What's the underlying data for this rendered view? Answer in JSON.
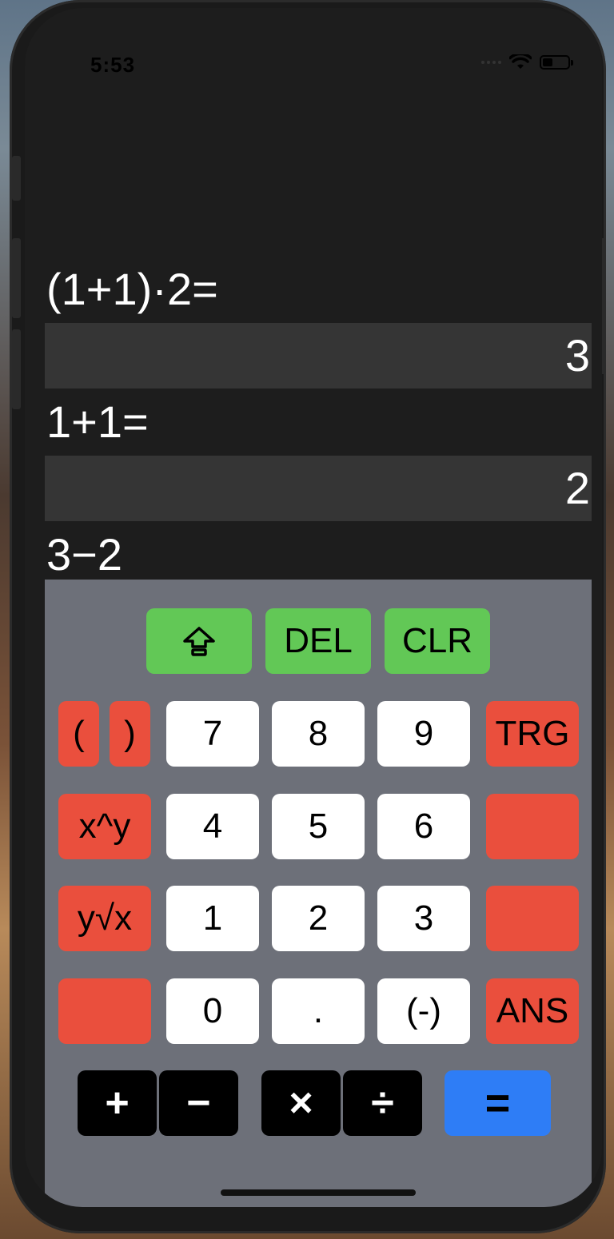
{
  "status_bar": {
    "time": "5:53"
  },
  "history": [
    {
      "expression": "(1+1)·2=",
      "result": "3"
    },
    {
      "expression": "1+1=",
      "result": "2"
    }
  ],
  "current_input": "3−2",
  "keys": {
    "shift": "⇪",
    "del": "DEL",
    "clr": "CLR",
    "open_paren": "(",
    "close_paren": ")",
    "seven": "7",
    "eight": "8",
    "nine": "9",
    "trg": "TRG",
    "power": "x^y",
    "four": "4",
    "five": "5",
    "six": "6",
    "root": "y√x",
    "one": "1",
    "two": "2",
    "three": "3",
    "zero": "0",
    "dot": ".",
    "negate": "(-)",
    "ans": "ANS",
    "plus": "+",
    "minus": "−",
    "times": "×",
    "divide": "÷",
    "equals": "="
  },
  "colors": {
    "function_keys": "#62c856",
    "special_keys": "#ea4f3d",
    "number_keys": "#ffffff",
    "operator_keys": "#000000",
    "equals_key": "#2e7df6",
    "keypad_bg": "#6d7079",
    "result_bg": "#353535"
  }
}
